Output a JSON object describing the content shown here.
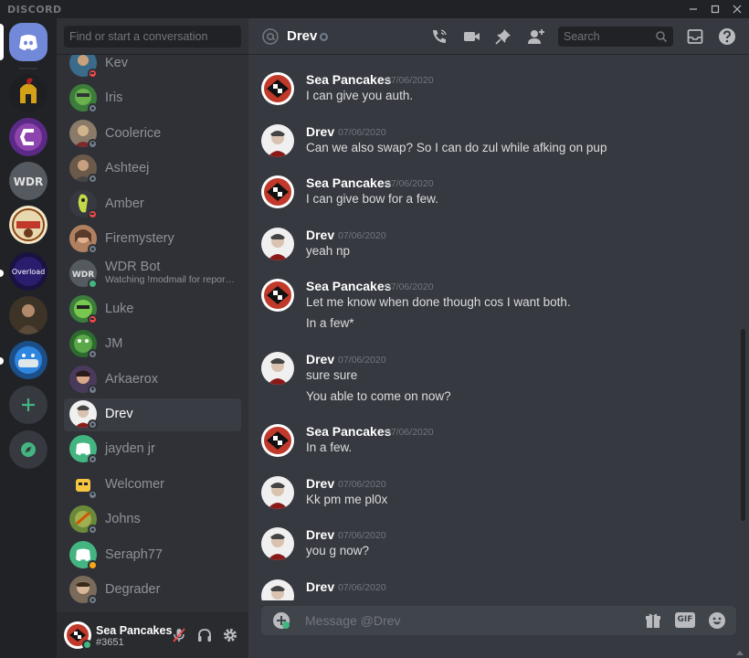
{
  "app": {
    "brand": "DISCORD"
  },
  "colors": {
    "blurple": "#7289da",
    "online": "#43b581",
    "dnd": "#f04747",
    "idle": "#faa61a",
    "offline": "#747f8d"
  },
  "window_controls": [
    "minimize-icon",
    "maximize-icon",
    "close-icon"
  ],
  "servers": [
    "home",
    "spartan-helmet-server",
    "c-logo-server",
    "wdr-server",
    "adobo-server",
    "overload-server",
    "portrait-server",
    "masked-face-server",
    "add-server",
    "explore-servers"
  ],
  "dm_search": {
    "placeholder": "Find or start a conversation"
  },
  "dms": [
    {
      "name": "Kev",
      "status": "dnd"
    },
    {
      "name": "Iris",
      "status": "offline"
    },
    {
      "name": "Coolerice",
      "status": "offline"
    },
    {
      "name": "Ashteej",
      "status": "offline"
    },
    {
      "name": "Amber",
      "status": "dnd"
    },
    {
      "name": "Firemystery",
      "status": "offline"
    },
    {
      "name": "WDR Bot",
      "sub": "Watching !modmail for repor…",
      "status": "online"
    },
    {
      "name": "Luke",
      "status": "dnd"
    },
    {
      "name": "JM",
      "status": "offline"
    },
    {
      "name": "Arkaerox",
      "status": "offline"
    },
    {
      "name": "Drev",
      "status": "offline",
      "active": true
    },
    {
      "name": "jayden jr",
      "status": "offline"
    },
    {
      "name": "Welcomer",
      "status": "offline"
    },
    {
      "name": "Johns",
      "status": "offline"
    },
    {
      "name": "Seraph77",
      "status": "idle"
    },
    {
      "name": "Degrader",
      "status": "offline"
    }
  ],
  "user": {
    "name": "Sea Pancakes",
    "tag": "#3651",
    "status": "online"
  },
  "header": {
    "name": "Drev",
    "search_placeholder": "Search"
  },
  "messages": [
    {
      "author": "Sea Pancakes",
      "time": "07/06/2020",
      "lines": [
        "I can give you auth."
      ]
    },
    {
      "author": "Drev",
      "time": "07/06/2020",
      "lines": [
        "Can we also swap? So I can do zul while afking on pup"
      ]
    },
    {
      "author": "Sea Pancakes",
      "time": "07/06/2020",
      "lines": [
        "I can give bow for a few."
      ]
    },
    {
      "author": "Drev",
      "time": "07/06/2020",
      "lines": [
        "yeah np"
      ]
    },
    {
      "author": "Sea Pancakes",
      "time": "07/06/2020",
      "lines": [
        "Let me know when done though cos I want both.",
        "In a few*"
      ]
    },
    {
      "author": "Drev",
      "time": "07/06/2020",
      "lines": [
        "sure sure",
        "You able to come on now?"
      ]
    },
    {
      "author": "Sea Pancakes",
      "time": "07/06/2020",
      "lines": [
        "In a few."
      ]
    },
    {
      "author": "Drev",
      "time": "07/06/2020",
      "lines": [
        "Kk pm me  pl0x"
      ]
    },
    {
      "author": "Drev",
      "time": "07/06/2020",
      "lines": [
        "you g now?"
      ]
    },
    {
      "author": "Drev",
      "time": "07/06/2020",
      "lines": []
    }
  ],
  "composer": {
    "placeholder": "Message @Drev",
    "gif_label": "GIF"
  }
}
